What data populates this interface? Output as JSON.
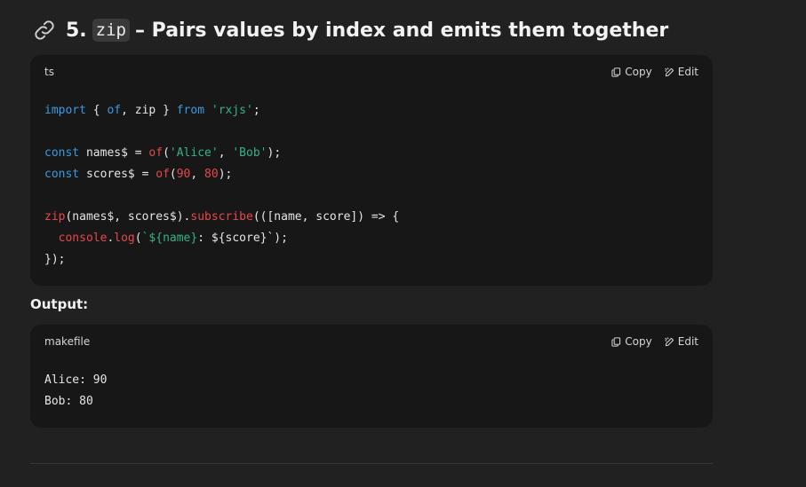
{
  "heading": {
    "number": "5.",
    "code": "zip",
    "title": "– Pairs values by index and emits them together"
  },
  "code_block_1": {
    "language": "ts",
    "copy_label": "Copy",
    "edit_label": "Edit",
    "lines": [
      "import { of, zip } from 'rxjs';",
      "",
      "const names$ = of('Alice', 'Bob');",
      "const scores$ = of(90, 80);",
      "",
      "zip(names$, scores$).subscribe(([name, score]) => {",
      "  console.log(`${name}: ${score}`);",
      "});"
    ]
  },
  "output_label": "Output:",
  "code_block_2": {
    "language": "makefile",
    "copy_label": "Copy",
    "edit_label": "Edit",
    "lines": [
      "Alice: 90",
      "Bob: 80"
    ]
  },
  "colors": {
    "background": "#212121",
    "code_background": "#171717",
    "keyword": "#3b9ae1",
    "function": "#e5484d",
    "string": "#34b384",
    "number": "#e5484d"
  },
  "icons": [
    "link-icon",
    "copy-icon",
    "edit-icon"
  ]
}
